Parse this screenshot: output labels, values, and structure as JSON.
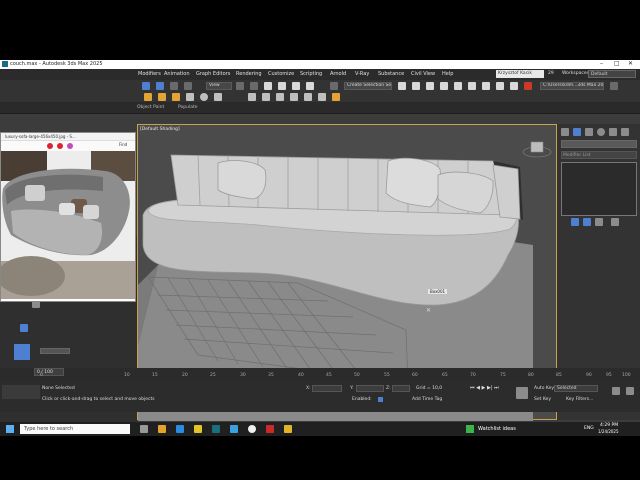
{
  "window": {
    "title": "couch.max - Autodesk 3ds Max 2025"
  },
  "menu": {
    "items": [
      "Modifiers",
      "Animation",
      "Graph Editors",
      "Rendering",
      "Customize",
      "Scripting",
      "Arnold",
      "V-Ray",
      "Substance",
      "Civil View",
      "Help"
    ],
    "signin": "Krzysztof Kacik",
    "count": "29",
    "workspaces_label": "Workspaces:",
    "workspace_value": "Default"
  },
  "toolbar": {
    "view_dropdown": "View",
    "selection_set": "Create Selection Se",
    "path": "C:\\Users\\kdm...3ds Max 2025"
  },
  "ribbon": {
    "object_paint": "Object Paint",
    "populate": "Populate"
  },
  "viewport": {
    "label": "[Default Shading]",
    "object_tag": "Box001"
  },
  "reference_window": {
    "title": "luxury-sofa-large-456x450.jpg - S...",
    "find": "Find"
  },
  "command_panel": {
    "modifier_list": "Modifier List"
  },
  "timeline": {
    "frame_counter": "0 / 100",
    "ticks": [
      "0",
      "10",
      "15",
      "20",
      "25",
      "30",
      "35",
      "40",
      "45",
      "50",
      "55",
      "60",
      "65",
      "70",
      "75",
      "80",
      "85",
      "90",
      "95",
      "100"
    ]
  },
  "status": {
    "selection": "None Selected",
    "prompt": "Click or click-and-drag to select and move objects",
    "x_label": "X:",
    "y_label": "Y:",
    "z_label": "Z:",
    "grid": "Grid = 10,0",
    "enabled": "Enabled:",
    "add_time_tag": "Add Time Tag",
    "auto_key": "Auto Key",
    "set_key": "Set Key",
    "selected": "Selected",
    "key_filters": "Key Filters..."
  },
  "taskbar": {
    "search": "Type here to search",
    "weather": "Watchlist ideas",
    "lang": "ENG",
    "time": "4:29 PM",
    "date": "1/24/2025"
  },
  "colors": {
    "viewport_border": "#c8a14a",
    "accent": "#1f6fd1"
  }
}
